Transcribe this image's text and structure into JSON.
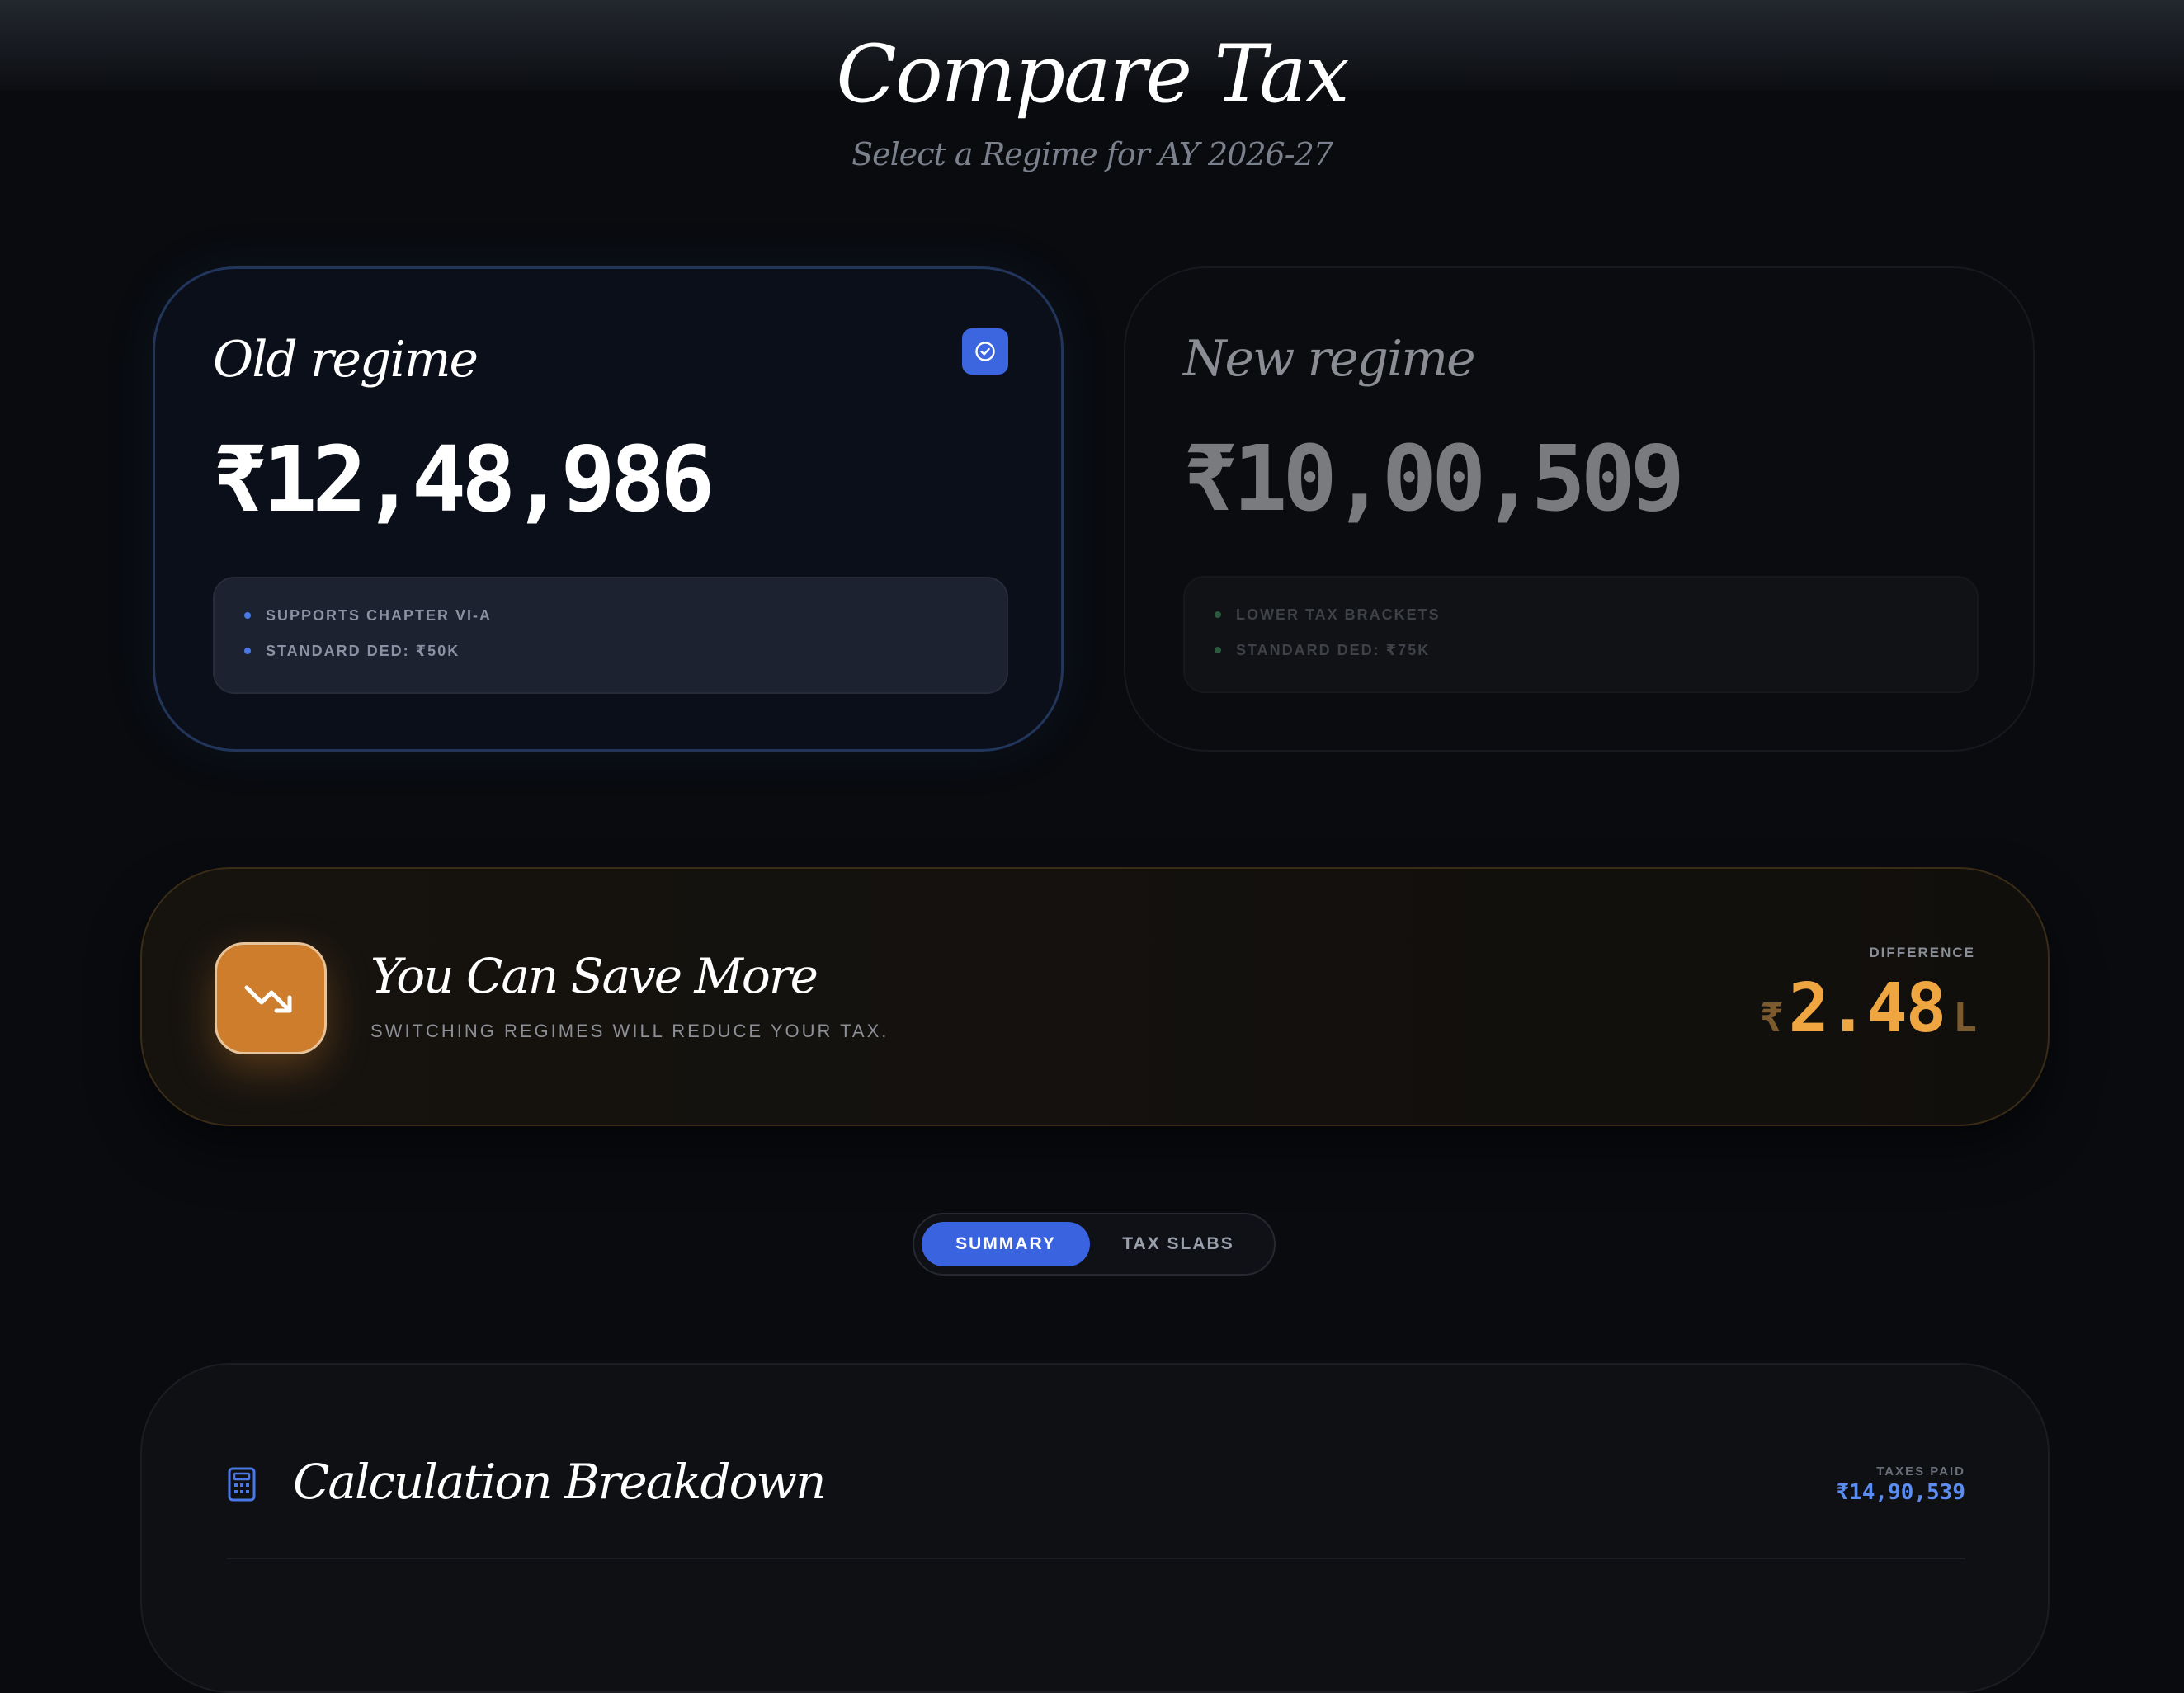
{
  "header": {
    "title": "Compare Tax",
    "subtitle": "Select a Regime for AY 2026-27"
  },
  "regimes": {
    "old": {
      "title": "Old regime",
      "amount": "₹12,48,986",
      "selected": true,
      "features": [
        "SUPPORTS CHAPTER VI-A",
        "STANDARD DED: ₹50K"
      ]
    },
    "new": {
      "title": "New regime",
      "amount": "₹10,00,509",
      "selected": false,
      "features": [
        "LOWER TAX BRACKETS",
        "STANDARD DED: ₹75K"
      ]
    }
  },
  "savings": {
    "title": "You Can Save More",
    "subtitle": "SWITCHING REGIMES WILL REDUCE YOUR TAX.",
    "difference_label": "DIFFERENCE",
    "difference_currency": "₹",
    "difference_value": "2.48",
    "difference_unit": "L",
    "icon": "trending-down-icon"
  },
  "tabs": {
    "summary": "SUMMARY",
    "tax_slabs": "TAX SLABS",
    "active": "summary"
  },
  "breakdown": {
    "title": "Calculation Breakdown",
    "taxes_paid_label": "TAXES PAID",
    "taxes_paid_value": "₹14,90,539",
    "icon": "calculator-icon"
  },
  "colors": {
    "accent_blue": "#3a63e0",
    "accent_orange": "#cd7d2c",
    "difference_orange": "#f0a640",
    "taxes_blue": "#5b8cf0"
  }
}
